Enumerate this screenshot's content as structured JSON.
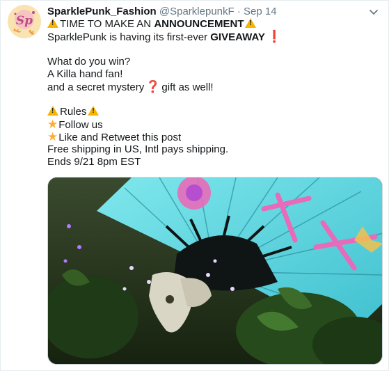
{
  "tweet": {
    "display_name": "SparklePunk_Fashion",
    "handle": "@SparklepunkF",
    "separator": "·",
    "date": "Sep 14",
    "avatar_text": "Sp",
    "lines": {
      "l1_pre": "TIME TO MAKE AN ",
      "l1_bold": "ANNOUNCEMENT",
      "l2_pre": "SparklePunk is having its first-ever ",
      "l2_bold": "GIVEAWAY",
      "l3": "What do you win?",
      "l4": "A Killa hand fan!",
      "l5_pre": "and a secret mystery",
      "l5_post": "gift as well!",
      "l6": "Rules",
      "l7": "Follow us",
      "l8": "Like and Retweet this post",
      "l9": "Free shipping in US, Intl pays shipping.",
      "l10": "Ends 9/21 8pm EST"
    },
    "emoji": {
      "warning": "warning-sign-icon",
      "exclamation": "❗",
      "question": "❓",
      "star": "★"
    }
  },
  "colors": {
    "text": "#14171a",
    "muted": "#657786",
    "fan_teal": "#5ed6df",
    "fan_pink": "#e86ab8",
    "warning": "#f7b500",
    "emoji_red": "#dd2e44"
  }
}
